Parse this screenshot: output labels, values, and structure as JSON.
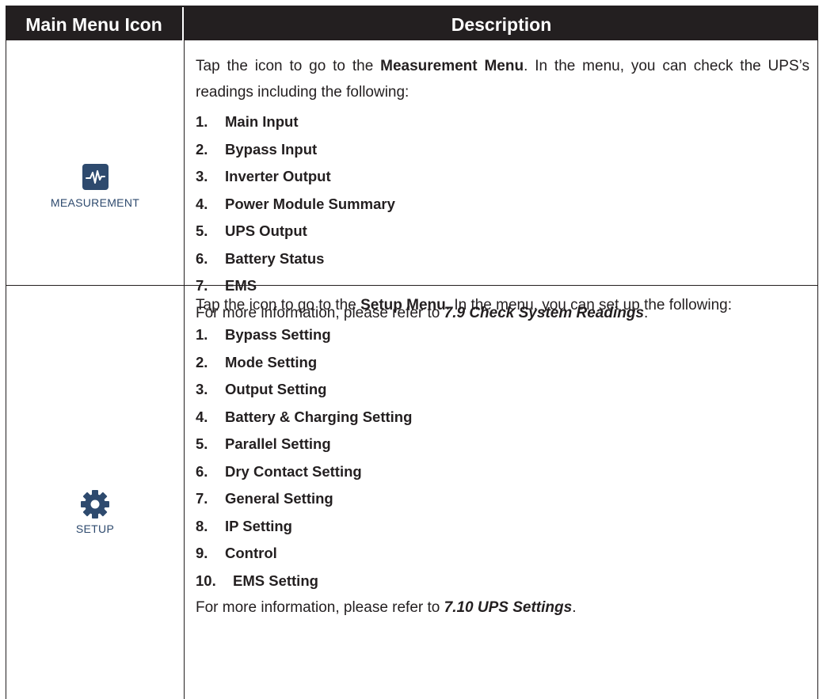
{
  "header": {
    "col1": "Main Menu Icon",
    "col2": "Description"
  },
  "rows": [
    {
      "icon": "measurement-pulse-icon",
      "icon_label": "MEASUREMENT",
      "intro_pre": "Tap the icon to go to the ",
      "intro_bold": "Measurement Menu",
      "intro_post": ". In the menu, you can check the UPS’s readings including the following:",
      "items": [
        {
          "num": "1.",
          "text": "Main Input"
        },
        {
          "num": "2.",
          "text": "Bypass Input"
        },
        {
          "num": "3.",
          "text": "Inverter Output"
        },
        {
          "num": "4.",
          "text": "Power Module Summary"
        },
        {
          "num": "5.",
          "text": "UPS Output"
        },
        {
          "num": "6.",
          "text": "Battery Status"
        },
        {
          "num": "7.",
          "text": "EMS"
        }
      ],
      "footer_pre": "For more information, please refer to ",
      "footer_ref": "7.9 Check System Readings",
      "footer_post": "."
    },
    {
      "icon": "gear-icon",
      "icon_label": "SETUP",
      "intro_pre": "Tap the icon to go to the ",
      "intro_bold": "Setup Menu",
      "intro_post": ". In the menu, you can set up the following:",
      "items": [
        {
          "num": "1.",
          "text": "Bypass Setting"
        },
        {
          "num": "2.",
          "text": "Mode Setting"
        },
        {
          "num": "3.",
          "text": "Output Setting"
        },
        {
          "num": "4.",
          "text": "Battery & Charging Setting"
        },
        {
          "num": "5.",
          "text": "Parallel Setting"
        },
        {
          "num": "6.",
          "text": "Dry Contact Setting"
        },
        {
          "num": "7.",
          "text": "General Setting"
        },
        {
          "num": "8.",
          "text": "IP Setting"
        },
        {
          "num": "9.",
          "text": "Control"
        },
        {
          "num": "10.",
          "text": "EMS Setting"
        }
      ],
      "footer_pre": "For more information, please refer to ",
      "footer_ref": "7.10 UPS Settings",
      "footer_post": "."
    }
  ],
  "colors": {
    "header_bg": "#231f20",
    "icon_tile": "#2e4a6e",
    "text": "#231f20"
  }
}
